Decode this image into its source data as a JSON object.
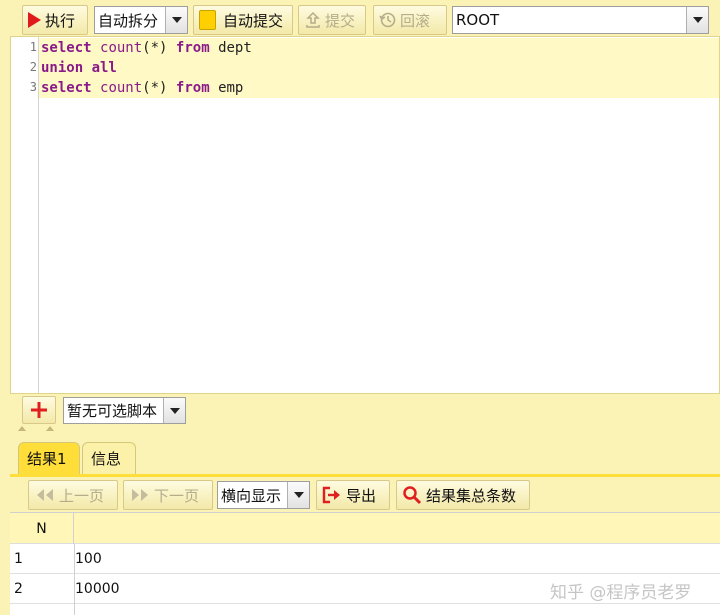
{
  "toolbar": {
    "execute_label": "执行",
    "split_mode_value": "自动拆分",
    "autocommit_label": "自动提交",
    "commit_label": "提交",
    "rollback_label": "回滚",
    "connection_value": "ROOT"
  },
  "editor": {
    "line_numbers": [
      "1",
      "2",
      "3"
    ]
  },
  "script_bar": {
    "script_select_value": "暂无可选脚本"
  },
  "results": {
    "tabs": [
      {
        "label": "结果1"
      },
      {
        "label": "信息"
      }
    ],
    "prev_page_label": "上一页",
    "next_page_label": "下一页",
    "display_mode_value": "横向显示",
    "export_label": "导出",
    "total_count_label": "结果集总条数",
    "columns": [
      {
        "header": "N"
      }
    ],
    "rows": [
      {
        "index": "1",
        "value": "100"
      },
      {
        "index": "2",
        "value": "10000"
      }
    ]
  },
  "watermark": "知乎 @程序员老罗",
  "colors": {
    "background": "#fbf3b5",
    "line_highlight": "#fff9c6",
    "keyword": "#8a1a8a",
    "run_icon": "#e01a1a",
    "add_icon": "#e02020"
  }
}
